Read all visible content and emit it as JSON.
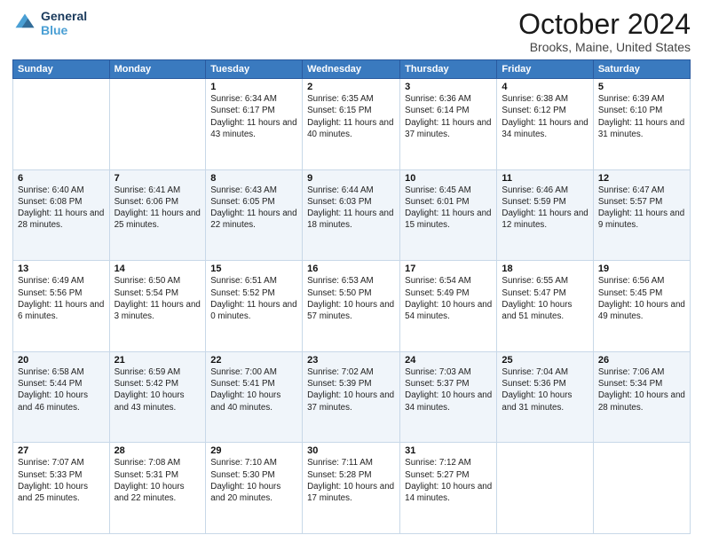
{
  "header": {
    "logo_line1": "General",
    "logo_line2": "Blue",
    "month_title": "October 2024",
    "location": "Brooks, Maine, United States"
  },
  "weekdays": [
    "Sunday",
    "Monday",
    "Tuesday",
    "Wednesday",
    "Thursday",
    "Friday",
    "Saturday"
  ],
  "weeks": [
    [
      {
        "day": "",
        "info": ""
      },
      {
        "day": "",
        "info": ""
      },
      {
        "day": "1",
        "info": "Sunrise: 6:34 AM\nSunset: 6:17 PM\nDaylight: 11 hours and 43 minutes."
      },
      {
        "day": "2",
        "info": "Sunrise: 6:35 AM\nSunset: 6:15 PM\nDaylight: 11 hours and 40 minutes."
      },
      {
        "day": "3",
        "info": "Sunrise: 6:36 AM\nSunset: 6:14 PM\nDaylight: 11 hours and 37 minutes."
      },
      {
        "day": "4",
        "info": "Sunrise: 6:38 AM\nSunset: 6:12 PM\nDaylight: 11 hours and 34 minutes."
      },
      {
        "day": "5",
        "info": "Sunrise: 6:39 AM\nSunset: 6:10 PM\nDaylight: 11 hours and 31 minutes."
      }
    ],
    [
      {
        "day": "6",
        "info": "Sunrise: 6:40 AM\nSunset: 6:08 PM\nDaylight: 11 hours and 28 minutes."
      },
      {
        "day": "7",
        "info": "Sunrise: 6:41 AM\nSunset: 6:06 PM\nDaylight: 11 hours and 25 minutes."
      },
      {
        "day": "8",
        "info": "Sunrise: 6:43 AM\nSunset: 6:05 PM\nDaylight: 11 hours and 22 minutes."
      },
      {
        "day": "9",
        "info": "Sunrise: 6:44 AM\nSunset: 6:03 PM\nDaylight: 11 hours and 18 minutes."
      },
      {
        "day": "10",
        "info": "Sunrise: 6:45 AM\nSunset: 6:01 PM\nDaylight: 11 hours and 15 minutes."
      },
      {
        "day": "11",
        "info": "Sunrise: 6:46 AM\nSunset: 5:59 PM\nDaylight: 11 hours and 12 minutes."
      },
      {
        "day": "12",
        "info": "Sunrise: 6:47 AM\nSunset: 5:57 PM\nDaylight: 11 hours and 9 minutes."
      }
    ],
    [
      {
        "day": "13",
        "info": "Sunrise: 6:49 AM\nSunset: 5:56 PM\nDaylight: 11 hours and 6 minutes."
      },
      {
        "day": "14",
        "info": "Sunrise: 6:50 AM\nSunset: 5:54 PM\nDaylight: 11 hours and 3 minutes."
      },
      {
        "day": "15",
        "info": "Sunrise: 6:51 AM\nSunset: 5:52 PM\nDaylight: 11 hours and 0 minutes."
      },
      {
        "day": "16",
        "info": "Sunrise: 6:53 AM\nSunset: 5:50 PM\nDaylight: 10 hours and 57 minutes."
      },
      {
        "day": "17",
        "info": "Sunrise: 6:54 AM\nSunset: 5:49 PM\nDaylight: 10 hours and 54 minutes."
      },
      {
        "day": "18",
        "info": "Sunrise: 6:55 AM\nSunset: 5:47 PM\nDaylight: 10 hours and 51 minutes."
      },
      {
        "day": "19",
        "info": "Sunrise: 6:56 AM\nSunset: 5:45 PM\nDaylight: 10 hours and 49 minutes."
      }
    ],
    [
      {
        "day": "20",
        "info": "Sunrise: 6:58 AM\nSunset: 5:44 PM\nDaylight: 10 hours and 46 minutes."
      },
      {
        "day": "21",
        "info": "Sunrise: 6:59 AM\nSunset: 5:42 PM\nDaylight: 10 hours and 43 minutes."
      },
      {
        "day": "22",
        "info": "Sunrise: 7:00 AM\nSunset: 5:41 PM\nDaylight: 10 hours and 40 minutes."
      },
      {
        "day": "23",
        "info": "Sunrise: 7:02 AM\nSunset: 5:39 PM\nDaylight: 10 hours and 37 minutes."
      },
      {
        "day": "24",
        "info": "Sunrise: 7:03 AM\nSunset: 5:37 PM\nDaylight: 10 hours and 34 minutes."
      },
      {
        "day": "25",
        "info": "Sunrise: 7:04 AM\nSunset: 5:36 PM\nDaylight: 10 hours and 31 minutes."
      },
      {
        "day": "26",
        "info": "Sunrise: 7:06 AM\nSunset: 5:34 PM\nDaylight: 10 hours and 28 minutes."
      }
    ],
    [
      {
        "day": "27",
        "info": "Sunrise: 7:07 AM\nSunset: 5:33 PM\nDaylight: 10 hours and 25 minutes."
      },
      {
        "day": "28",
        "info": "Sunrise: 7:08 AM\nSunset: 5:31 PM\nDaylight: 10 hours and 22 minutes."
      },
      {
        "day": "29",
        "info": "Sunrise: 7:10 AM\nSunset: 5:30 PM\nDaylight: 10 hours and 20 minutes."
      },
      {
        "day": "30",
        "info": "Sunrise: 7:11 AM\nSunset: 5:28 PM\nDaylight: 10 hours and 17 minutes."
      },
      {
        "day": "31",
        "info": "Sunrise: 7:12 AM\nSunset: 5:27 PM\nDaylight: 10 hours and 14 minutes."
      },
      {
        "day": "",
        "info": ""
      },
      {
        "day": "",
        "info": ""
      }
    ]
  ]
}
